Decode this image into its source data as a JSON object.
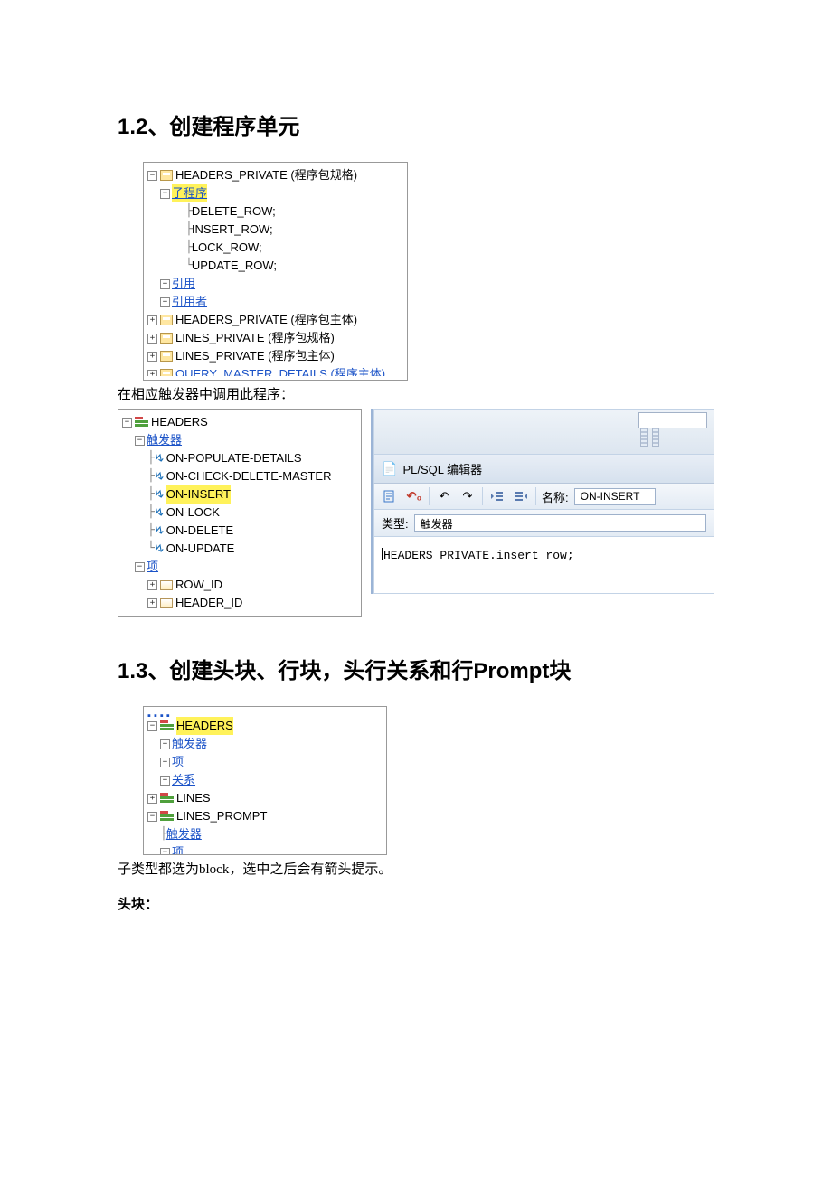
{
  "section12": {
    "heading": "1.2、创建程序单元",
    "tree1": {
      "n1": "HEADERS_PRIVATE (程序包规格)",
      "sub": "子程序",
      "p1": "DELETE_ROW;",
      "p2": "INSERT_ROW;",
      "p3": "LOCK_ROW;",
      "p4": "UPDATE_ROW;",
      "ref1": "引用",
      "ref2": "引用者",
      "n2": "HEADERS_PRIVATE (程序包主体)",
      "n3": "LINES_PRIVATE (程序包规格)",
      "n4": "LINES_PRIVATE (程序包主体)"
    },
    "caption1": "在相应触发器中调用此程序：",
    "tree2": {
      "h": "HEADERS",
      "trig": "触发器",
      "t1": "ON-POPULATE-DETAILS",
      "t2": "ON-CHECK-DELETE-MASTER",
      "t3": "ON-INSERT",
      "t4": "ON-LOCK",
      "t5": "ON-DELETE",
      "t6": "ON-UPDATE",
      "items": "项",
      "i1": "ROW_ID",
      "i2": "HEADER_ID"
    },
    "editor": {
      "title": "PL/SQL 编辑器",
      "name_lbl": "名称:",
      "name_val": "ON-INSERT",
      "type_lbl": "类型:",
      "type_val": "触发器",
      "code": "HEADERS_PRIVATE.insert_row;"
    }
  },
  "section13": {
    "heading": "1.3、创建头块、行块，头行关系和行Prompt块",
    "tree": {
      "h": "HEADERS",
      "trig": "触发器",
      "items": "项",
      "rel": "关系",
      "lines": "LINES",
      "lp": "LINES_PROMPT",
      "trig2": "触发器",
      "items2": "项"
    },
    "caption": "子类型都选为block，选中之后会有箭头提示。",
    "label": "头块："
  }
}
